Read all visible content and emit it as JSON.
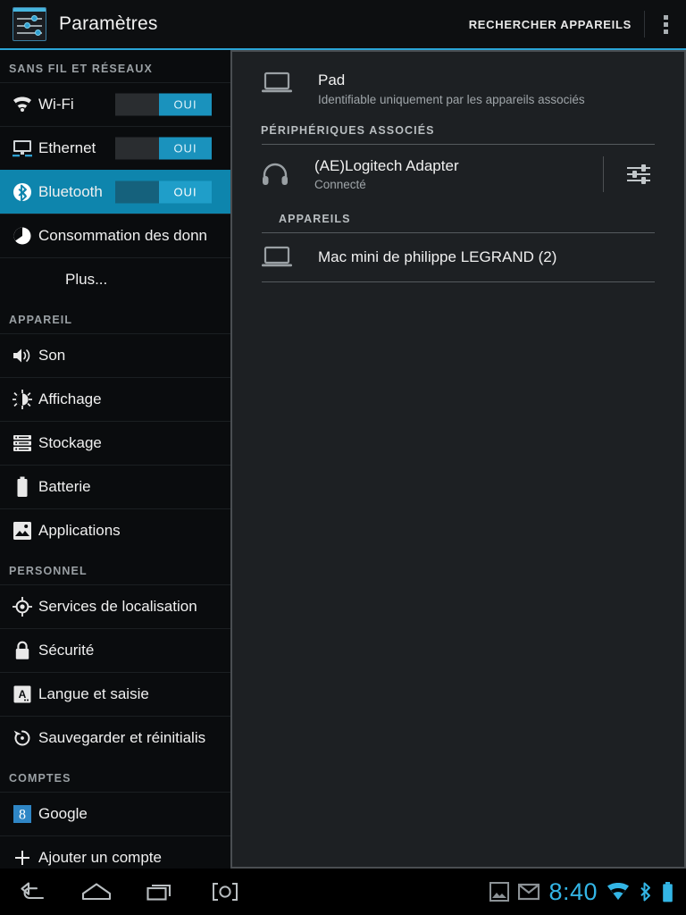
{
  "header": {
    "app_icon": "settings-sliders-icon",
    "title": "Paramètres",
    "search_action": "RECHERCHER APPAREILS",
    "overflow_icon": "overflow-menu-icon",
    "accent_color": "#2aa5d6"
  },
  "sidebar": {
    "sections": [
      {
        "label": "SANS FIL ET RÉSEAUX",
        "items": [
          {
            "icon": "wifi-icon",
            "label": "Wi-Fi",
            "toggle": "OUI",
            "selected": false
          },
          {
            "icon": "ethernet-icon",
            "label": "Ethernet",
            "toggle": "OUI",
            "selected": false
          },
          {
            "icon": "bluetooth-icon",
            "label": "Bluetooth",
            "toggle": "OUI",
            "selected": true
          },
          {
            "icon": "data-usage-icon",
            "label": "Consommation des donn",
            "toggle": null,
            "selected": false
          },
          {
            "icon": null,
            "label": "Plus...",
            "toggle": null,
            "selected": false
          }
        ]
      },
      {
        "label": "APPAREIL",
        "items": [
          {
            "icon": "sound-icon",
            "label": "Son",
            "toggle": null,
            "selected": false
          },
          {
            "icon": "display-icon",
            "label": "Affichage",
            "toggle": null,
            "selected": false
          },
          {
            "icon": "storage-icon",
            "label": "Stockage",
            "toggle": null,
            "selected": false
          },
          {
            "icon": "battery-icon",
            "label": "Batterie",
            "toggle": null,
            "selected": false
          },
          {
            "icon": "applications-icon",
            "label": "Applications",
            "toggle": null,
            "selected": false
          }
        ]
      },
      {
        "label": "PERSONNEL",
        "items": [
          {
            "icon": "location-icon",
            "label": "Services de localisation",
            "toggle": null,
            "selected": false
          },
          {
            "icon": "lock-icon",
            "label": "Sécurité",
            "toggle": null,
            "selected": false
          },
          {
            "icon": "language-icon",
            "label": "Langue et saisie",
            "toggle": null,
            "selected": false
          },
          {
            "icon": "backup-restore-icon",
            "label": "Sauvegarder et réinitialis",
            "toggle": null,
            "selected": false
          }
        ]
      },
      {
        "label": "COMPTES",
        "items": [
          {
            "icon": "google-icon",
            "label": "Google",
            "toggle": null,
            "selected": false
          },
          {
            "icon": "add-account-icon",
            "label": "Ajouter un compte",
            "toggle": null,
            "selected": false
          }
        ]
      }
    ],
    "selected_row_color": "#0e85ad",
    "toggle_color": "#1a92bd"
  },
  "panel": {
    "self_device": {
      "icon": "laptop-icon",
      "name": "Pad",
      "subtitle": "Identifiable uniquement par les appareils associés"
    },
    "paired_section": {
      "label": "PÉRIPHÉRIQUES ASSOCIÉS",
      "devices": [
        {
          "icon": "headphones-icon",
          "name": "(AE)Logitech Adapter",
          "status": "Connecté",
          "settings_icon": "device-settings-sliders-icon"
        }
      ]
    },
    "available_section": {
      "label": "APPAREILS",
      "devices": [
        {
          "icon": "laptop-icon",
          "name": "Mac mini de philippe LEGRAND (2)"
        }
      ]
    }
  },
  "system_bar": {
    "nav": [
      {
        "icon": "back-icon",
        "label": "Retour"
      },
      {
        "icon": "home-icon",
        "label": "Accueil"
      },
      {
        "icon": "recents-icon",
        "label": "Applications récentes"
      },
      {
        "icon": "screenshot-icon",
        "label": "Capture d'écran"
      }
    ],
    "status": {
      "image_icon": "image-notification-icon",
      "mail_icon": "gmail-notification-icon",
      "time": "8:40",
      "wifi_icon": "wifi-status-icon",
      "bluetooth_icon": "bluetooth-status-icon",
      "battery_icon": "battery-status-icon",
      "accent_color": "#33b5e5"
    }
  }
}
